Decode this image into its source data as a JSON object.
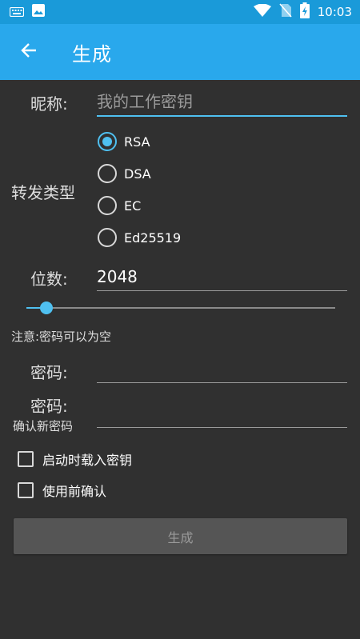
{
  "status_bar": {
    "time": "10:03",
    "icons": [
      "keyboard-icon",
      "image-icon",
      "wifi-icon",
      "no-sim-icon",
      "battery-charging-icon"
    ]
  },
  "app_bar": {
    "title": "生成",
    "back_icon": "arrow-left-icon"
  },
  "form": {
    "nickname_label": "昵称:",
    "nickname_placeholder": "我的工作密钥",
    "type_label": "转发类型",
    "types": [
      {
        "label": "RSA",
        "checked": true
      },
      {
        "label": "DSA",
        "checked": false
      },
      {
        "label": "EC",
        "checked": false
      },
      {
        "label": "Ed25519",
        "checked": false
      }
    ],
    "bits_label": "位数:",
    "bits_value": "2048",
    "slider_position": 0.065,
    "note": "注意:密码可以为空",
    "password_label": "密码:",
    "password_confirm_label": "密码:",
    "password_confirm_hint": "确认新密码",
    "checkboxes": [
      {
        "label": "启动时载入密钥",
        "checked": false
      },
      {
        "label": "使用前确认",
        "checked": false
      }
    ],
    "generate_label": "生成"
  },
  "colors": {
    "status_bar": "#1a9ad9",
    "app_bar": "#29a8ec",
    "accent": "#4fc0f0",
    "background": "#303030"
  }
}
